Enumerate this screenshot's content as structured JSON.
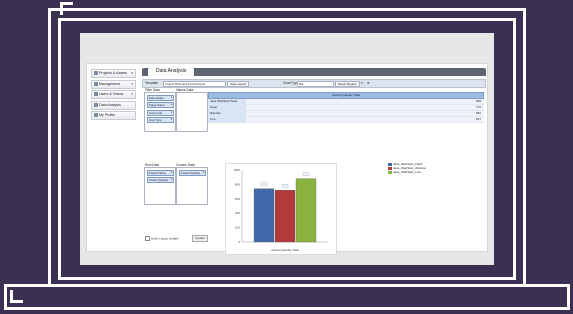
{
  "sidebar": {
    "items": [
      {
        "label": "Projects & Assets",
        "icon": "folder-icon"
      },
      {
        "label": "Management",
        "icon": "list-icon"
      },
      {
        "label": "Users & Teams",
        "icon": "users-icon"
      },
      {
        "label": "Data Analysis",
        "icon": "chart-icon"
      },
      {
        "label": "My Profile",
        "icon": "user-icon"
      }
    ]
  },
  "tab": {
    "label": "Data Analysis"
  },
  "toolbar": {
    "template_label": "Template",
    "template_value": "Project Bids-and-Final Awards",
    "save_label": "Save saved",
    "chart_type_label": "Chart Type",
    "chart_type_value": "Bar",
    "options_label": "Select Region"
  },
  "filters": {
    "filter_header": "Filter Data",
    "filter_chips": [
      "Date Added",
      "Stage Name",
      "Cost Code",
      "Cost Type"
    ],
    "values_header": "Values Data",
    "row_header": "Row Data",
    "row_chips": [
      "Project Name",
      "Award Quantity"
    ],
    "column_header": "Column Data",
    "column_chips": [
      "Award Quantity"
    ],
    "defer_label": "Defer Layout Update",
    "update_label": "Update"
  },
  "grid": {
    "header": "Award Quantity Total",
    "rows": [
      {
        "label": "Java WebStart Suite",
        "value": "808"
      },
      {
        "label": "Hope",
        "value": "776"
      },
      {
        "label": "Window",
        "value": "882"
      },
      {
        "label": "Live",
        "value": "847"
      }
    ]
  },
  "chart_data": {
    "type": "bar",
    "categories": [
      "Award Quantity Total"
    ],
    "series": [
      {
        "name": "Java_WebStart_Flash",
        "values": [
          740
        ],
        "color": "#3f69a8"
      },
      {
        "name": "Java_WebStart_Window",
        "values": [
          720
        ],
        "color": "#b23a3a"
      },
      {
        "name": "Java_WebStart_Live",
        "values": [
          880
        ],
        "color": "#8ab23f"
      }
    ],
    "xlabel": "Award Quantity Total",
    "ylabel": "",
    "ylim": [
      0,
      1000
    ],
    "yticks": [
      "0",
      "100",
      "200",
      "300",
      "400",
      "500",
      "600",
      "700",
      "800",
      "900",
      "1000"
    ],
    "legend": "right"
  }
}
